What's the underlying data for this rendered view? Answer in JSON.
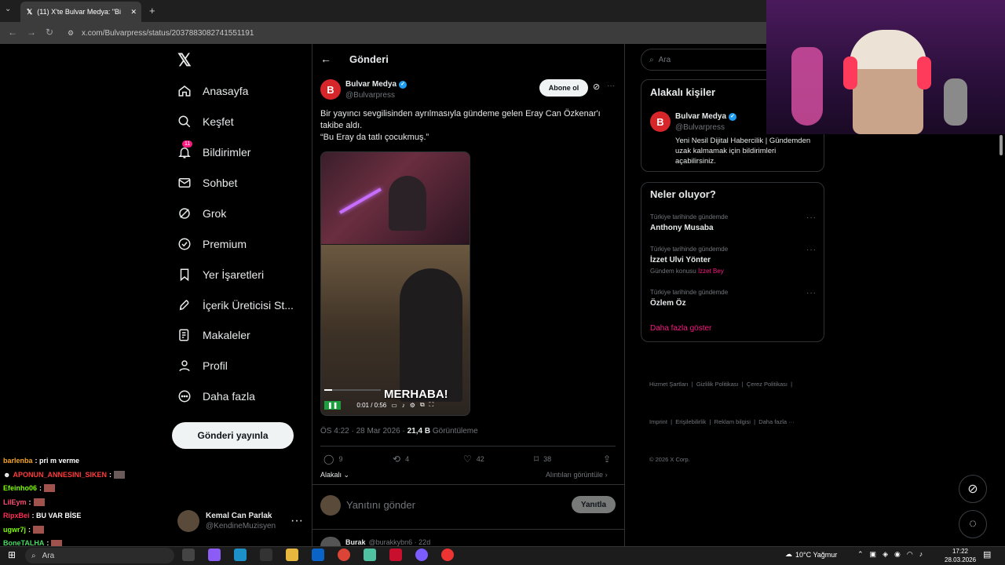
{
  "browser": {
    "tab_title": "(11) X'te Bulvar Medya: \"Bi",
    "url": "x.com/Bulvarpress/status/2037883082741551191"
  },
  "sidebar": {
    "items": [
      {
        "label": "Anasayfa",
        "icon": "home-icon"
      },
      {
        "label": "Keşfet",
        "icon": "search-icon"
      },
      {
        "label": "Bildirimler",
        "icon": "bell-icon",
        "badge": "11"
      },
      {
        "label": "Sohbet",
        "icon": "mail-icon"
      },
      {
        "label": "Grok",
        "icon": "grok-icon"
      },
      {
        "label": "Premium",
        "icon": "premium-icon"
      },
      {
        "label": "Yer İşaretleri",
        "icon": "bookmark-icon"
      },
      {
        "label": "İçerik Üreticisi St...",
        "icon": "rocket-icon"
      },
      {
        "label": "Makaleler",
        "icon": "article-icon"
      },
      {
        "label": "Profil",
        "icon": "profile-icon"
      },
      {
        "label": "Daha fazla",
        "icon": "more-icon"
      }
    ],
    "post_button": "Gönderi yayınla",
    "account": {
      "name": "Kemal Can Parlak",
      "handle": "@KendineMuzisyen"
    }
  },
  "main": {
    "header_title": "Gönderi",
    "author": {
      "name": "Bulvar Medya",
      "handle": "@Bulvarpress"
    },
    "subscribe_label": "Abone ol",
    "tweet_line1": "Bir yayıncı sevgilisinden ayrılmasıyla gündeme gelen Eray Can Özkenar'ı",
    "tweet_line2": "takibe aldı.",
    "tweet_line3": "“Bu Eray da tatlı çocukmuş.”",
    "video": {
      "time": "0:01 / 0:56",
      "caption": "MERHABA!",
      "progress": 0.02
    },
    "meta_time": "ÖS 4:22 · 28 Mar 2026 · ",
    "views": "21,4 B",
    "views_label": " Görüntüleme",
    "actions": {
      "replies": "9",
      "reposts": "4",
      "likes": "42",
      "bookmarks": "38"
    },
    "related_label": "Alakalı",
    "quotes_label": "Alıntıları görüntüle",
    "reply_placeholder": "Yanıtını gönder",
    "reply_button": "Yanıtla",
    "next_author": "Burak",
    "next_handle": "@burakkybn6 · 22d"
  },
  "right": {
    "search_placeholder": "Ara",
    "related_people_title": "Alakalı kişiler",
    "related": {
      "name": "Bulvar Medya",
      "handle": "@Bulvarpress",
      "bio": "Yeni Nesil Dijital Habercilik | Gündemden uzak kalmamak için bildirimleri açabilirsiniz."
    },
    "whats_happening_title": "Neler oluyor?",
    "trends": [
      {
        "context": "Türkiye tarihinde gündemde",
        "name": "Anthony Musaba",
        "extra": "",
        "extra_link": ""
      },
      {
        "context": "Türkiye tarihinde gündemde",
        "name": "İzzet Ulvi Yönter",
        "extra": "Gündem konusu",
        "extra_link": "İzzet Bey"
      },
      {
        "context": "Türkiye tarihinde gündemde",
        "name": "Özlem Öz",
        "extra": "",
        "extra_link": ""
      }
    ],
    "show_more": "Daha fazla göster",
    "footer1": "Hizmet Şartları  |  Gizlilik Politikası  |  Çerez Politikası  |",
    "footer2": "Imprint  |  Erişilebilirlik  |  Reklam bilgisi  |  Daha fazla ···",
    "footer3": "© 2026 X Corp."
  },
  "chat": [
    {
      "user": "barlenba",
      "color": "#f5a623",
      "msg": ": pri m verme"
    },
    {
      "user": "APONUN_ANNESINI_SIKEN",
      "color": "#ff3b3b",
      "msg": ":"
    },
    {
      "user": "Efeinho06",
      "color": "#7cfc00",
      "msg": ":"
    },
    {
      "user": "LilEym",
      "color": "#ff4d6d",
      "msg": ":"
    },
    {
      "user": "RipxBei",
      "color": "#ff2d55",
      "msg": ": BU VAR BİSE"
    },
    {
      "user": "ugwr7j",
      "color": "#7cfc00",
      "msg": ":"
    },
    {
      "user": "BoneTALHA",
      "color": "#4cd964",
      "msg": ":"
    }
  ],
  "taskbar": {
    "search": "Ara",
    "weather": "10°C  Yağmur",
    "time": "17:22",
    "date": "28.03.2026"
  }
}
